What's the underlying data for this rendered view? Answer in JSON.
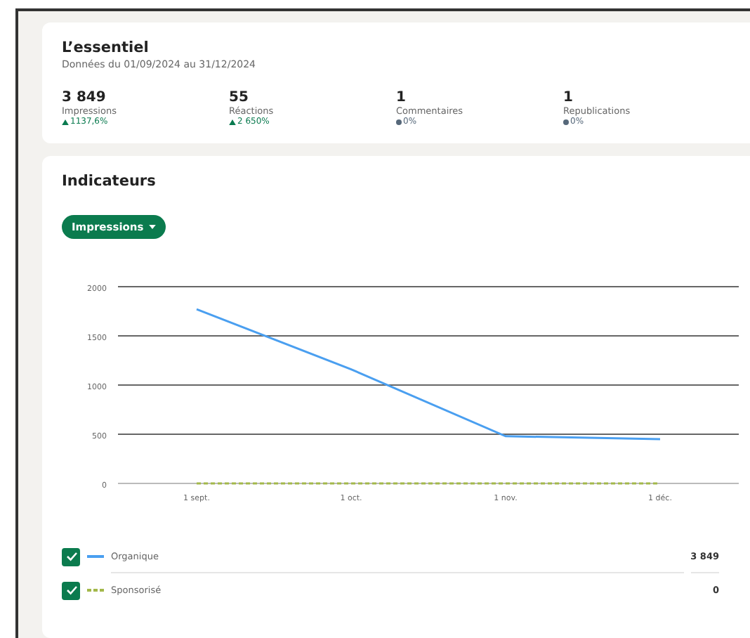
{
  "summary": {
    "title": "L’essentiel",
    "subtitle": "Données du 01/09/2024 au 31/12/2024",
    "metrics": [
      {
        "value": "3 849",
        "label": "Impressions",
        "change": "1137,6%",
        "kind": "up"
      },
      {
        "value": "55",
        "label": "Réactions",
        "change": "2 650%",
        "kind": "up"
      },
      {
        "value": "1",
        "label": "Commentaires",
        "change": "0%",
        "kind": "flat"
      },
      {
        "value": "1",
        "label": "Republications",
        "change": "0%",
        "kind": "flat"
      }
    ]
  },
  "indicators": {
    "title": "Indicateurs",
    "dropdown": "Impressions",
    "chart_data": {
      "type": "line",
      "categories": [
        "1 sept.",
        "1 oct.",
        "1 nov.",
        "1 déc."
      ],
      "ylim": [
        0,
        2000
      ],
      "yticks": [
        0,
        500,
        1000,
        1500,
        2000
      ],
      "grid": true,
      "series": [
        {
          "name": "Organique",
          "color": "#4a9ff0",
          "line_style": "solid",
          "values": [
            1770,
            1160,
            480,
            450
          ]
        },
        {
          "name": "Sponsorisé",
          "color": "#a3b84a",
          "line_style": "dashed",
          "values": [
            0,
            0,
            0,
            0
          ]
        }
      ]
    },
    "legend": [
      {
        "total": "3 849",
        "checked": true
      },
      {
        "total": "0",
        "checked": true
      }
    ]
  }
}
